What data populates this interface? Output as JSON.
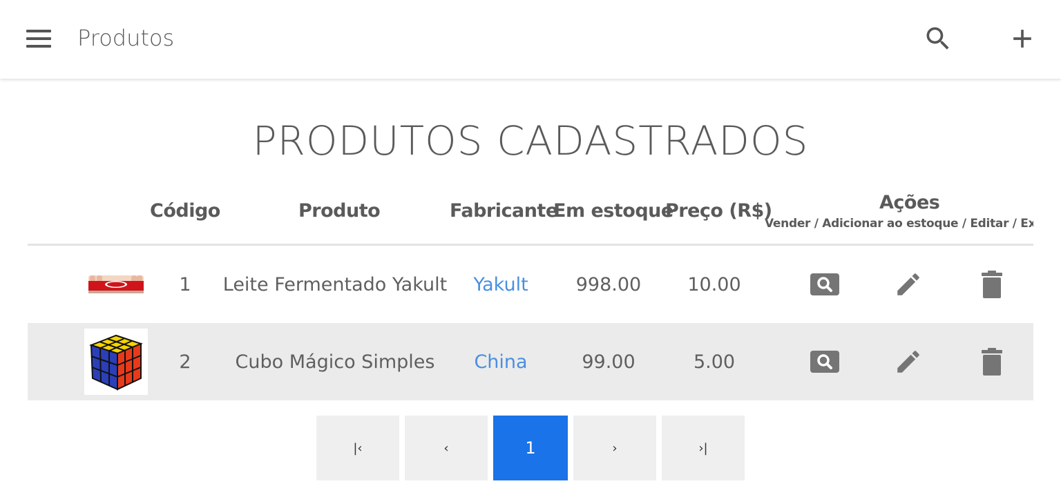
{
  "appbar": {
    "title": "Produtos",
    "icons": {
      "menu": "menu-icon",
      "search": "search-icon",
      "add": "plus-icon"
    }
  },
  "page": {
    "title": "PRODUTOS CADASTRADOS"
  },
  "table": {
    "headers": {
      "code": "Código",
      "product": "Produto",
      "manufacturer": "Fabricante",
      "stock": "Em estoque",
      "price": "Preço (R$)",
      "actions": "Ações",
      "actions_sub": "Vender / Adicionar ao estoque / Editar / Excluir"
    },
    "rows": [
      {
        "code": "1",
        "product": "Leite Fermentado Yakult",
        "manufacturer": "Yakult",
        "stock": "998.00",
        "price": "10.00",
        "image_icon": "yakult-product-image"
      },
      {
        "code": "2",
        "product": "Cubo Mágico Simples",
        "manufacturer": "China",
        "stock": "99.00",
        "price": "5.00",
        "image_icon": "rubiks-cube-product-image"
      }
    ],
    "action_icons": [
      "search-box-icon",
      "pencil-icon",
      "trash-icon"
    ]
  },
  "pagination": {
    "first": "|‹",
    "prev": "‹",
    "current": "1",
    "next": "›",
    "last": "›|"
  },
  "colors": {
    "accent": "#1a73e8",
    "link": "#4a8fe0",
    "row_alt": "#ebebeb",
    "icon": "#757575"
  }
}
